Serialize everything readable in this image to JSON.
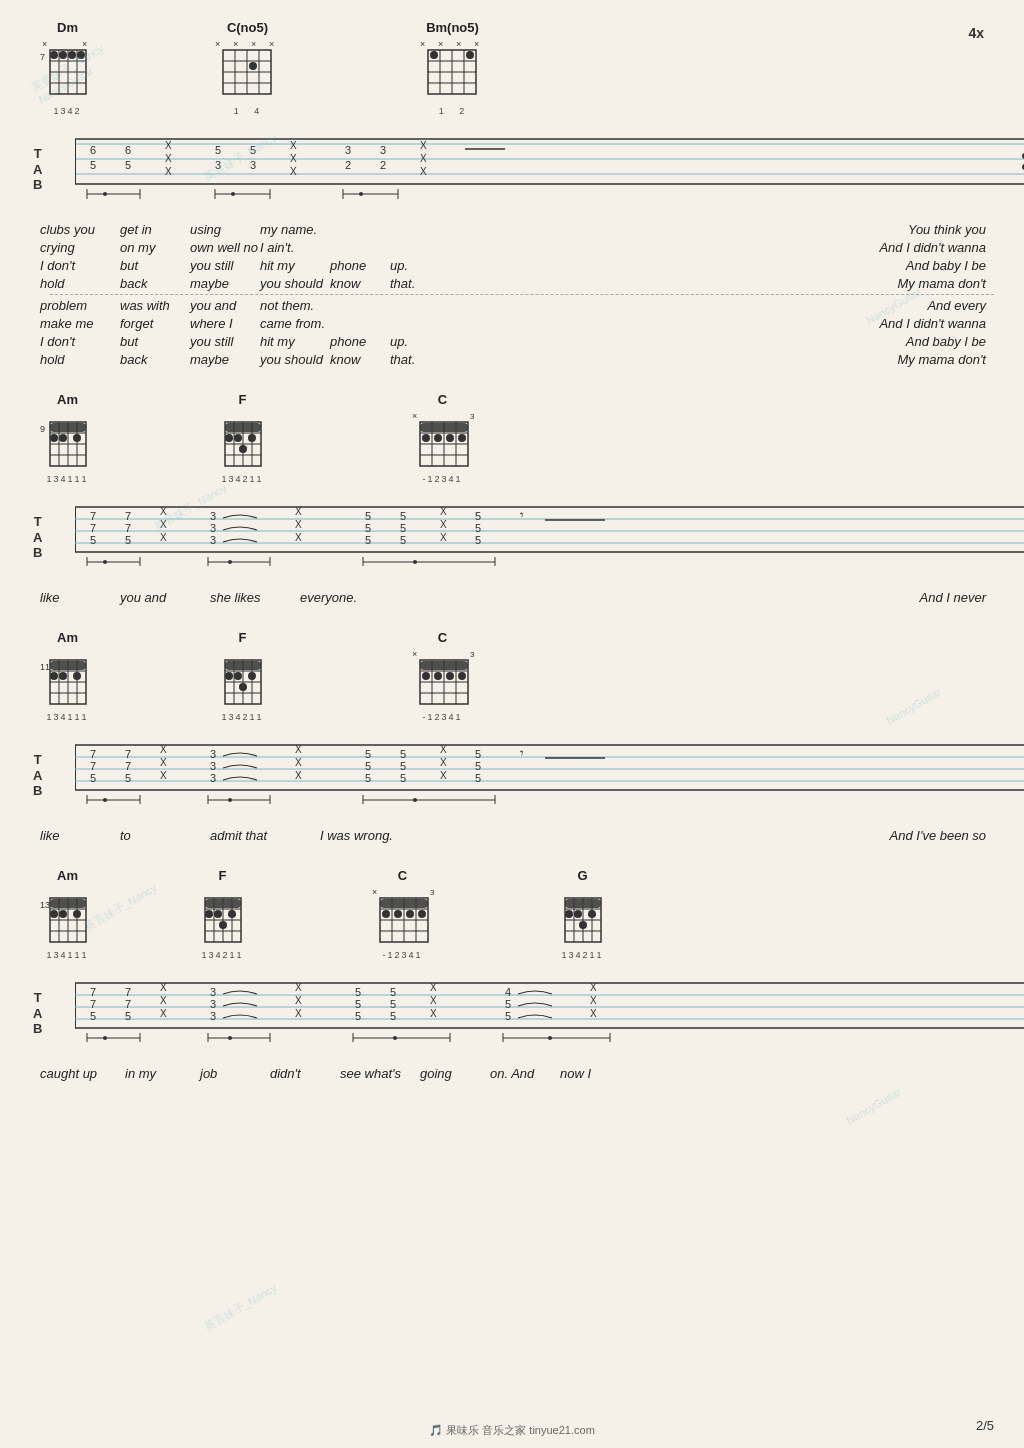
{
  "page": {
    "number": "2/5",
    "background": "#f5f0e8"
  },
  "sections": [
    {
      "id": "section1",
      "chords": [
        {
          "name": "Dm",
          "mute": "x  x",
          "fingers": "1342",
          "fret": "7",
          "svgDots": [
            [
              0,
              0
            ],
            [
              1,
              0
            ],
            [
              2,
              0
            ],
            [
              3,
              0
            ]
          ]
        },
        {
          "name": "C(no5)",
          "mute": "x xx x",
          "fingers": "1  4",
          "fret": "",
          "svgDots": []
        },
        {
          "name": "Bm(no5)",
          "mute": "x xx x",
          "fingers": "1  2",
          "fret": "",
          "svgDots": []
        }
      ],
      "repeatMark": "4x",
      "tabSvg": "section1-tab",
      "lyricsGroups": [
        {
          "lines": [
            {
              "cells": [
                "clubs you",
                "get in",
                "using",
                "my name."
              ],
              "right": "You think you"
            },
            {
              "cells": [
                "crying",
                "on my",
                "own well no",
                "I ain't."
              ],
              "right": "And I didn't wanna"
            },
            {
              "cells": [
                "I don't",
                "but",
                "you still",
                "hit my",
                "phone",
                "up."
              ],
              "right": "And baby I be"
            },
            {
              "cells": [
                "hold",
                "back",
                "maybe",
                "you should",
                "know",
                "that."
              ],
              "right": "My mama don't"
            }
          ],
          "divider": true
        },
        {
          "lines": [
            {
              "cells": [
                "problem",
                "was with",
                "you and",
                "not them."
              ],
              "right": "And every"
            },
            {
              "cells": [
                "make me",
                "forget",
                "where I",
                "came from."
              ],
              "right": "And I didn't wanna"
            },
            {
              "cells": [
                "I don't",
                "but",
                "you still",
                "hit my",
                "phone",
                "up."
              ],
              "right": "And baby I be"
            },
            {
              "cells": [
                "hold",
                "back",
                "maybe",
                "you should",
                "know",
                "that."
              ],
              "right": "My mama don't"
            }
          ],
          "divider": false
        }
      ]
    },
    {
      "id": "section2",
      "chords": [
        {
          "name": "Am",
          "fingers": "134111",
          "fret": "9"
        },
        {
          "name": "F",
          "fingers": "134211",
          "fret": ""
        },
        {
          "name": "C",
          "fingers": "-12341",
          "fret": "3",
          "mute": "x"
        }
      ],
      "tabSvg": "section2-tab",
      "lyricsGroups": [
        {
          "lines": [
            {
              "cells": [
                "like",
                "you and",
                "she likes",
                "everyone."
              ],
              "right": "And I never"
            }
          ],
          "divider": false
        }
      ]
    },
    {
      "id": "section3",
      "chords": [
        {
          "name": "Am",
          "fingers": "134111",
          "fret": "11"
        },
        {
          "name": "F",
          "fingers": "134211",
          "fret": ""
        },
        {
          "name": "C",
          "fingers": "-12341",
          "fret": "3",
          "mute": "x"
        }
      ],
      "tabSvg": "section3-tab",
      "lyricsGroups": [
        {
          "lines": [
            {
              "cells": [
                "like",
                "to",
                "admit that",
                "I was wrong."
              ],
              "right": "And I've been so"
            }
          ],
          "divider": false
        }
      ]
    },
    {
      "id": "section4",
      "chords": [
        {
          "name": "Am",
          "fingers": "134111",
          "fret": "13"
        },
        {
          "name": "F",
          "fingers": "134211",
          "fret": ""
        },
        {
          "name": "C",
          "fingers": "-12341",
          "fret": "3",
          "mute": "x"
        },
        {
          "name": "G",
          "fingers": "134211",
          "fret": ""
        }
      ],
      "tabSvg": "section4-tab",
      "lyricsGroups": [
        {
          "lines": [
            {
              "cells": [
                "caught up",
                "in my",
                "job",
                "didn't",
                "see what's",
                "going",
                "on. And",
                "now I"
              ],
              "right": ""
            }
          ],
          "divider": false
        }
      ]
    }
  ],
  "labels": {
    "tab_t": "T",
    "tab_a": "A",
    "tab_b": "B"
  }
}
